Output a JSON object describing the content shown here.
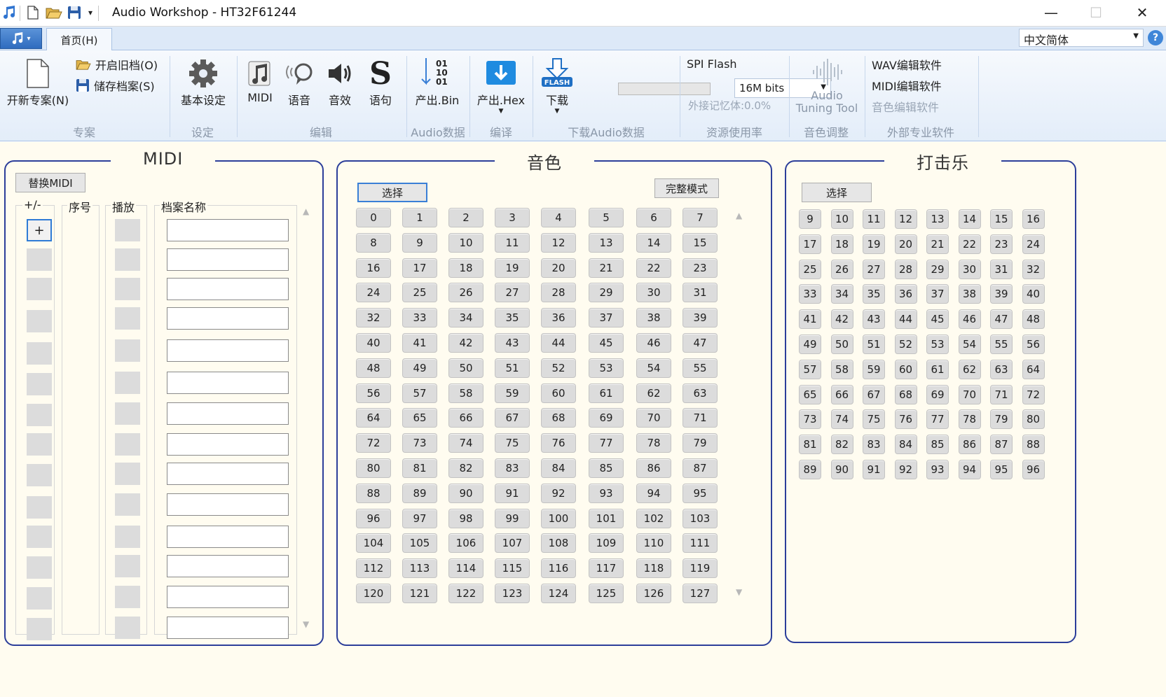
{
  "window": {
    "title": "Audio Workshop - HT32F61244",
    "minimize": "—",
    "maximize": "☐",
    "close": "✕"
  },
  "tabs": {
    "home": "首页(H)"
  },
  "language": {
    "value": "中文简体"
  },
  "ribbon": {
    "new_project": "开新专案(N)",
    "open_old": "开启旧档(O)",
    "save_file": "储存档案(S)",
    "group_project": "专案",
    "basic_settings": "基本设定",
    "group_settings": "设定",
    "midi": "MIDI",
    "voice": "语音",
    "sound_effect": "音效",
    "sentence": "语句",
    "group_edit": "编辑",
    "output_bin": "产出.Bin",
    "group_audio_data": "Audio数据",
    "output_hex": "产出.Hex",
    "group_compile": "编译",
    "download": "下载",
    "group_download": "下载Audio数据",
    "spi_flash": "SPI Flash",
    "spi_size": "16M bits",
    "external_memory": "外接记忆体:0.0%",
    "group_resource": "资源使用率",
    "audio_tuning_line1": "Audio",
    "audio_tuning_line2": "Tuning Tool",
    "group_tone_adjust": "音色调整",
    "wav_editor": "WAV编辑软件",
    "midi_editor": "MIDI编辑软件",
    "tone_editor": "音色编辑软件",
    "group_external": "外部专业软件",
    "download_progress": 0
  },
  "midi_panel": {
    "title": "MIDI",
    "replace_button": "替换MIDI",
    "col_plusminus": "+/-",
    "col_index": "序号",
    "col_play": "播放",
    "col_filename": "档案名称",
    "add_button": "+"
  },
  "tone_panel": {
    "title": "音色",
    "select_button": "选择",
    "full_mode_button": "完整模式",
    "numbers": [
      "0",
      "1",
      "2",
      "3",
      "4",
      "5",
      "6",
      "7",
      "8",
      "9",
      "10",
      "11",
      "12",
      "13",
      "14",
      "15",
      "16",
      "17",
      "18",
      "19",
      "20",
      "21",
      "22",
      "23",
      "24",
      "25",
      "26",
      "27",
      "28",
      "29",
      "30",
      "31",
      "32",
      "33",
      "34",
      "35",
      "36",
      "37",
      "38",
      "39",
      "40",
      "41",
      "42",
      "43",
      "44",
      "45",
      "46",
      "47",
      "48",
      "49",
      "50",
      "51",
      "52",
      "53",
      "54",
      "55",
      "56",
      "57",
      "58",
      "59",
      "60",
      "61",
      "62",
      "63",
      "64",
      "65",
      "66",
      "67",
      "68",
      "69",
      "70",
      "71",
      "72",
      "73",
      "74",
      "75",
      "76",
      "77",
      "78",
      "79",
      "80",
      "81",
      "82",
      "83",
      "84",
      "85",
      "86",
      "87",
      "88",
      "89",
      "90",
      "91",
      "92",
      "93",
      "94",
      "95",
      "96",
      "97",
      "98",
      "99",
      "100",
      "101",
      "102",
      "103",
      "104",
      "105",
      "106",
      "107",
      "108",
      "109",
      "110",
      "111",
      "112",
      "113",
      "114",
      "115",
      "116",
      "117",
      "118",
      "119",
      "120",
      "121",
      "122",
      "123",
      "124",
      "125",
      "126",
      "127"
    ]
  },
  "percussion_panel": {
    "title": "打击乐",
    "select_button": "选择",
    "numbers": [
      "9",
      "10",
      "11",
      "12",
      "13",
      "14",
      "15",
      "16",
      "17",
      "18",
      "19",
      "20",
      "21",
      "22",
      "23",
      "24",
      "25",
      "26",
      "27",
      "28",
      "29",
      "30",
      "31",
      "32",
      "33",
      "34",
      "35",
      "36",
      "37",
      "38",
      "39",
      "40",
      "41",
      "42",
      "43",
      "44",
      "45",
      "46",
      "47",
      "48",
      "49",
      "50",
      "51",
      "52",
      "53",
      "54",
      "55",
      "56",
      "57",
      "58",
      "59",
      "60",
      "61",
      "62",
      "63",
      "64",
      "65",
      "66",
      "67",
      "68",
      "69",
      "70",
      "71",
      "72",
      "73",
      "74",
      "75",
      "76",
      "77",
      "78",
      "79",
      "80",
      "81",
      "82",
      "83",
      "84",
      "85",
      "86",
      "87",
      "88",
      "89",
      "90",
      "91",
      "92",
      "93",
      "94",
      "95",
      "96"
    ]
  },
  "icons": {
    "app": "music-note-icon",
    "new": "new-file-icon",
    "open": "open-folder-icon",
    "save": "floppy-disk-icon",
    "settings": "gear-icon",
    "midi": "midi-note-icon",
    "voice": "speech-icon",
    "effect": "speaker-icon",
    "sentence": "s-letter-icon",
    "bin": "binary-down-icon",
    "hex": "hex-down-icon",
    "download": "flash-download-icon",
    "tuning": "waveform-icon",
    "help": "help-icon"
  }
}
